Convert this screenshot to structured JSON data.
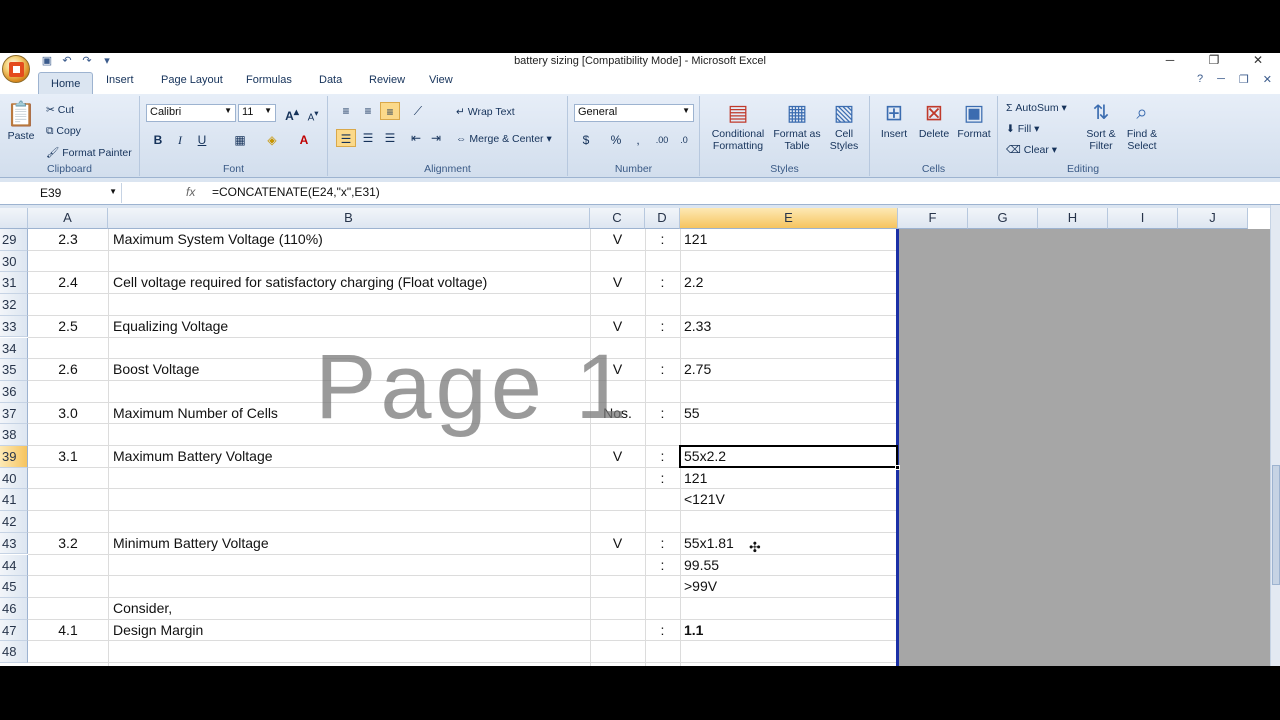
{
  "window": {
    "title": "battery sizing  [Compatibility Mode] - Microsoft Excel",
    "minimize": "─",
    "restore": "❐",
    "close": "✕"
  },
  "tabs": [
    "Home",
    "Insert",
    "Page Layout",
    "Formulas",
    "Data",
    "Review",
    "View"
  ],
  "ribbon": {
    "clipboard": {
      "name": "Clipboard",
      "paste": "Paste",
      "cut": "Cut",
      "copy": "Copy",
      "format_painter": "Format Painter"
    },
    "font": {
      "name": "Font",
      "family": "Calibri",
      "size": "11"
    },
    "alignment": {
      "name": "Alignment",
      "wrap_text": "Wrap Text",
      "merge_center": "Merge & Center"
    },
    "number": {
      "name": "Number",
      "format": "General"
    },
    "styles": {
      "name": "Styles",
      "conditional": "Conditional Formatting",
      "format_table": "Format as Table",
      "cell_styles": "Cell Styles"
    },
    "cells": {
      "name": "Cells",
      "insert": "Insert",
      "delete": "Delete",
      "format": "Format"
    },
    "editing": {
      "name": "Editing",
      "autosum": "AutoSum",
      "fill": "Fill",
      "clear": "Clear",
      "sort_filter": "Sort & Filter",
      "find_select": "Find & Select"
    }
  },
  "formula_bar": {
    "name_box": "E39",
    "fx": "fx",
    "formula": "=CONCATENATE(E24,\"x\",E31)"
  },
  "columns": [
    "A",
    "B",
    "C",
    "D",
    "E",
    "F",
    "G",
    "H",
    "I",
    "J"
  ],
  "rows": [
    {
      "n": "29",
      "a": "2.3",
      "b": "Maximum System Voltage (110%)",
      "c": "V",
      "d": ":",
      "e": "121"
    },
    {
      "n": "30",
      "a": "",
      "b": "",
      "c": "",
      "d": "",
      "e": ""
    },
    {
      "n": "31",
      "a": "2.4",
      "b": "Cell voltage required for satisfactory charging (Float voltage)",
      "c": "V",
      "d": ":",
      "e": "2.2"
    },
    {
      "n": "32",
      "a": "",
      "b": "",
      "c": "",
      "d": "",
      "e": ""
    },
    {
      "n": "33",
      "a": "2.5",
      "b": "Equalizing Voltage",
      "c": "V",
      "d": ":",
      "e": "2.33"
    },
    {
      "n": "34",
      "a": "",
      "b": "",
      "c": "",
      "d": "",
      "e": ""
    },
    {
      "n": "35",
      "a": "2.6",
      "b": "Boost Voltage",
      "c": "V",
      "d": ":",
      "e": "2.75"
    },
    {
      "n": "36",
      "a": "",
      "b": "",
      "c": "",
      "d": "",
      "e": ""
    },
    {
      "n": "37",
      "a": "3.0",
      "b": "Maximum Number of Cells",
      "c": "Nos.",
      "d": ":",
      "e": "55"
    },
    {
      "n": "38",
      "a": "",
      "b": "",
      "c": "",
      "d": "",
      "e": ""
    },
    {
      "n": "39",
      "a": "3.1",
      "b": "Maximum Battery Voltage",
      "c": "V",
      "d": ":",
      "e": "55x2.2"
    },
    {
      "n": "40",
      "a": "",
      "b": "",
      "c": "",
      "d": ":",
      "e": "121"
    },
    {
      "n": "41",
      "a": "",
      "b": "",
      "c": "",
      "d": "",
      "e": "<121V"
    },
    {
      "n": "42",
      "a": "",
      "b": "",
      "c": "",
      "d": "",
      "e": ""
    },
    {
      "n": "43",
      "a": "3.2",
      "b": "Minimum Battery Voltage",
      "c": "V",
      "d": ":",
      "e": "55x1.81"
    },
    {
      "n": "44",
      "a": "",
      "b": "",
      "c": "",
      "d": ":",
      "e": "99.55"
    },
    {
      "n": "45",
      "a": "",
      "b": "",
      "c": "",
      "d": "",
      "e": ">99V"
    },
    {
      "n": "46",
      "a": "",
      "b": "Consider,",
      "c": "",
      "d": "",
      "e": ""
    },
    {
      "n": "47",
      "a": "4.1",
      "b": "Design Margin",
      "c": "",
      "d": ":",
      "e": "1.1"
    },
    {
      "n": "48",
      "a": "",
      "b": "",
      "c": "",
      "d": "",
      "e": ""
    }
  ],
  "watermark": "Page 1",
  "active_cell": "E39"
}
